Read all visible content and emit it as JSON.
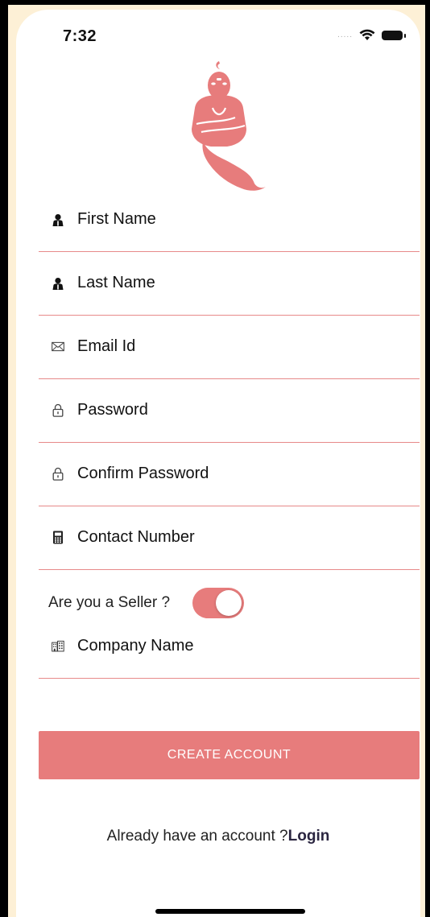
{
  "status_bar": {
    "time": "7:32",
    "signal_dots": "....."
  },
  "form": {
    "first_name": {
      "placeholder": "First Name",
      "icon": "person-icon"
    },
    "last_name": {
      "placeholder": "Last Name",
      "icon": "person-icon"
    },
    "email": {
      "placeholder": "Email Id",
      "icon": "envelope-icon"
    },
    "password": {
      "placeholder": "Password",
      "icon": "lock-icon"
    },
    "confirm_password": {
      "placeholder": "Confirm Password",
      "icon": "lock-icon"
    },
    "contact": {
      "placeholder": "Contact Number",
      "icon": "phone-icon"
    },
    "seller_label": "Are you a Seller ?",
    "seller_toggle_on": true,
    "company": {
      "placeholder": "Company Name",
      "icon": "building-icon"
    }
  },
  "actions": {
    "create_account": "CREATE ACCOUNT",
    "already_text": "Already have an account ?",
    "login_link": "Login"
  },
  "colors": {
    "accent": "#e77c7c",
    "underline": "#e78a8a",
    "background": "#ffffff"
  }
}
